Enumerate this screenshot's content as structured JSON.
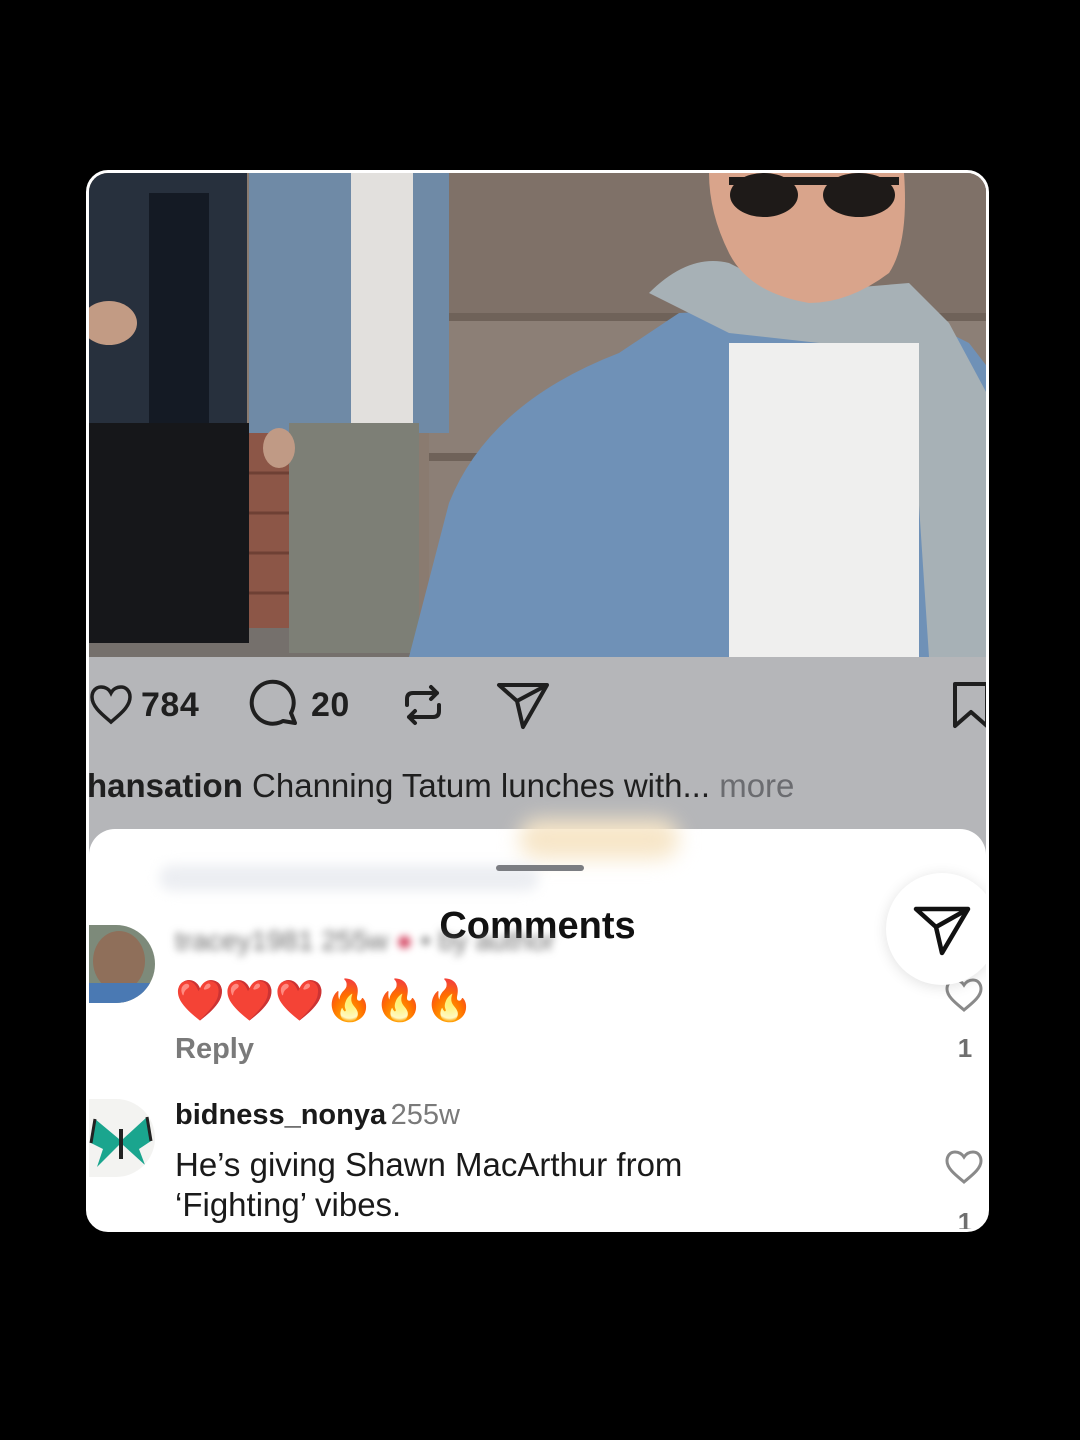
{
  "post": {
    "likes": "784",
    "comments": "20",
    "caption_user": "hansation",
    "caption_text": "Channing Tatum lunches with...",
    "caption_more": "more",
    "icons": [
      "heart-icon",
      "comment-icon",
      "repost-icon",
      "share-icon",
      "bookmark-icon"
    ]
  },
  "sheet": {
    "title": "Comments"
  },
  "comments": [
    {
      "user": "tracey1981",
      "time": "255w",
      "extra": "• by author",
      "text": "❤️❤️❤️🔥🔥🔥",
      "reply": "Reply",
      "likes": "1"
    },
    {
      "user": "bidness_nonya",
      "time": "255w",
      "text_line1": "He’s giving Shawn MacArthur from",
      "text_line2": "‘Fighting’ vibes.",
      "likes": "1"
    }
  ],
  "colors": {
    "background": "#000000",
    "post_dim": "#b5b6b9",
    "text": "#1a1a1a",
    "muted": "#7a7a7a"
  }
}
